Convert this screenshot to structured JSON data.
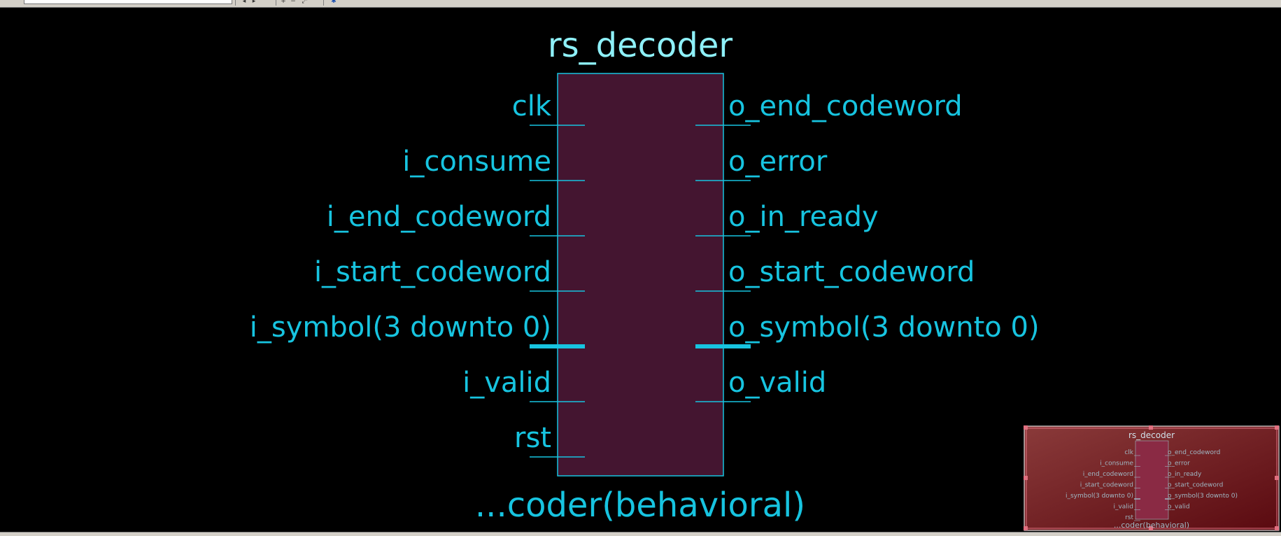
{
  "toolbar": {
    "search_value": "",
    "buttons": [
      {
        "name": "back-icon",
        "glyph": "◂"
      },
      {
        "name": "forward-icon",
        "glyph": "▸"
      },
      {
        "name": "zoom-in-icon",
        "glyph": "+"
      },
      {
        "name": "zoom-out-icon",
        "glyph": "−"
      },
      {
        "name": "zoom-fit-icon",
        "glyph": "⤢"
      },
      {
        "name": "pin-icon",
        "glyph": "✱"
      }
    ]
  },
  "schematic": {
    "entity_name": "rs_decoder",
    "architecture_label": "...coder(behavioral)",
    "inputs": [
      {
        "name": "clk",
        "bus": false
      },
      {
        "name": "i_consume",
        "bus": false
      },
      {
        "name": "i_end_codeword",
        "bus": false
      },
      {
        "name": "i_start_codeword",
        "bus": false
      },
      {
        "name": "i_symbol(3 downto 0)",
        "bus": true
      },
      {
        "name": "i_valid",
        "bus": false
      },
      {
        "name": "rst",
        "bus": false
      }
    ],
    "outputs": [
      {
        "name": "o_end_codeword",
        "bus": false
      },
      {
        "name": "o_error",
        "bus": false
      },
      {
        "name": "o_in_ready",
        "bus": false
      },
      {
        "name": "o_start_codeword",
        "bus": false
      },
      {
        "name": "o_symbol(3 downto 0)",
        "bus": true
      },
      {
        "name": "o_valid",
        "bus": false
      }
    ]
  },
  "minimap": {
    "title": "rs_decoder",
    "architecture_label": "...coder(behavioral)"
  },
  "colors": {
    "block_fill": "#441530",
    "block_stroke": "#17c4e0",
    "wire": "#17c4e0",
    "minimap_bg": "#7a2228",
    "minimap_border": "#e07080"
  }
}
